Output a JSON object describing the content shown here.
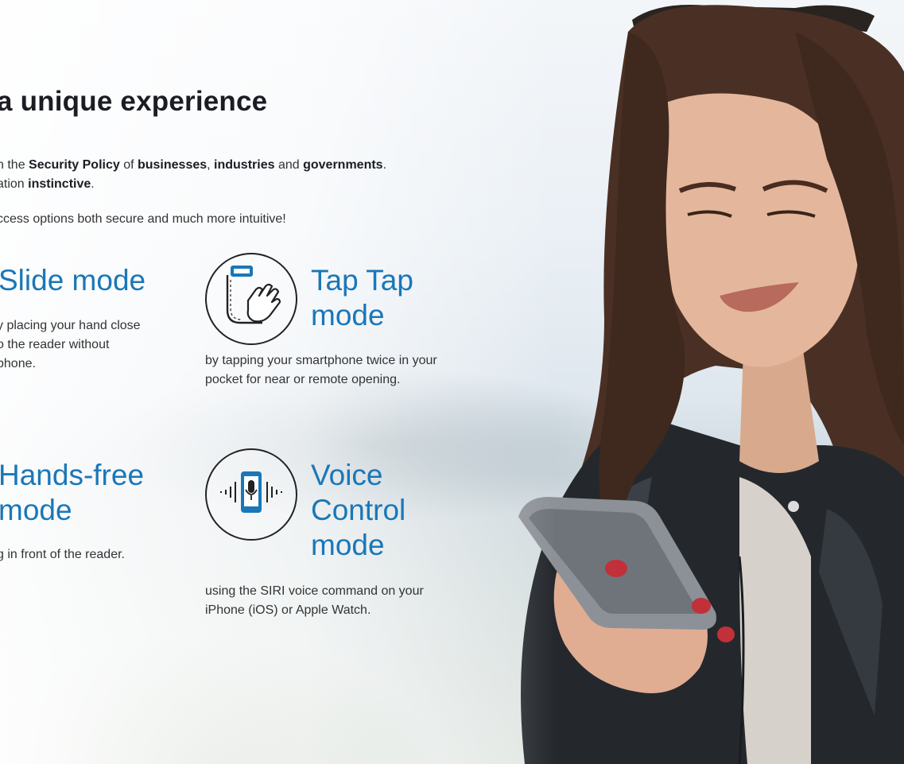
{
  "hero": {
    "headline": "a unique experience",
    "intro_line1": {
      "t1": "n the ",
      "b1": "Security Policy",
      "t2": " of ",
      "b2": "businesses",
      "t3": ", ",
      "b3": "industries",
      "t4": " and ",
      "b4": "governments",
      "t5": "."
    },
    "intro_line2": {
      "t1": "ation ",
      "b1": "instinctive",
      "t2": "."
    },
    "intro_line3": "ccess options both secure and much more intuitive!"
  },
  "modes": {
    "slide": {
      "title": "Slide mode",
      "desc_line1": "y placing your hand close",
      "desc_line2": "o the reader without",
      "desc_line3": "phone."
    },
    "tap_tap": {
      "title_line1": "Tap Tap",
      "title_line2": "mode",
      "desc_line1": "by tapping your smartphone twice in your",
      "desc_line2": "pocket for near or remote opening.",
      "icon": "tap-phone-pocket-icon"
    },
    "hands_free": {
      "title_line1": "Hands-free",
      "title_line2": "mode",
      "desc_line1": "g in front of the reader."
    },
    "voice_control": {
      "title_line1": "Voice",
      "title_line2": "Control",
      "title_line3": "mode",
      "desc_line1": "using the SIRI voice command on your",
      "desc_line2": "iPhone (iOS) or Apple Watch.",
      "icon": "microphone-phone-icon"
    }
  },
  "colors": {
    "accent": "#1a77b8",
    "headline": "#1c1c24",
    "body": "#333333"
  }
}
